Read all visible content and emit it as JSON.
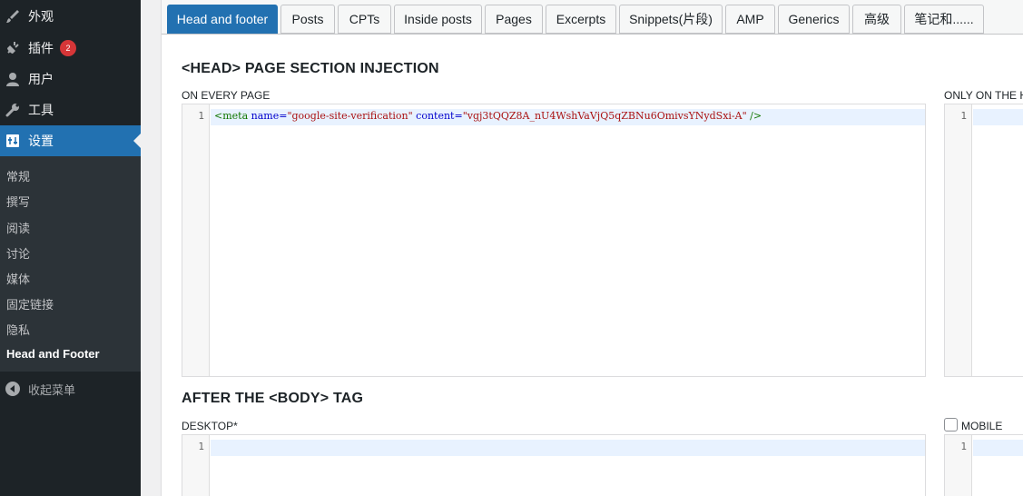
{
  "sidebar": {
    "menu": [
      {
        "label": "外观",
        "icon": "paintbrush-icon"
      },
      {
        "label": "插件",
        "icon": "plugin-icon",
        "badge": "2"
      },
      {
        "label": "用户",
        "icon": "user-icon"
      },
      {
        "label": "工具",
        "icon": "wrench-icon"
      },
      {
        "label": "设置",
        "icon": "settings-icon"
      }
    ],
    "submenu": [
      "常规",
      "撰写",
      "阅读",
      "讨论",
      "媒体",
      "固定链接",
      "隐私",
      "Head and Footer"
    ],
    "collapse_label": "收起菜单"
  },
  "tabs": [
    "Head and footer",
    "Posts",
    "CPTs",
    "Inside posts",
    "Pages",
    "Excerpts",
    "Snippets(片段)",
    "AMP",
    "Generics",
    "高级",
    "笔记和......"
  ],
  "head_section": {
    "title": "<HEAD> PAGE SECTION INJECTION",
    "every_page_label": "ON EVERY PAGE",
    "home_label": "ONLY ON THE H",
    "line_number": "1",
    "code": {
      "open": "<meta",
      "name_attr": "name=",
      "name_val": "\"google-site-verification\"",
      "content_attr": "content=",
      "content_val": "\"vgj3tQQZ8A_nU4WshVaVjQ5qZBNu6OmivsYNydSxi-A\"",
      "close": "/>"
    }
  },
  "body_section": {
    "title": "AFTER THE <BODY> TAG",
    "desktop_label": "DESKTOP*",
    "mobile_label": "MOBILE",
    "line_number": "1"
  },
  "colors": {
    "sidebar_bg": "#1d2327",
    "accent": "#2271b1",
    "badge": "#d63638"
  }
}
